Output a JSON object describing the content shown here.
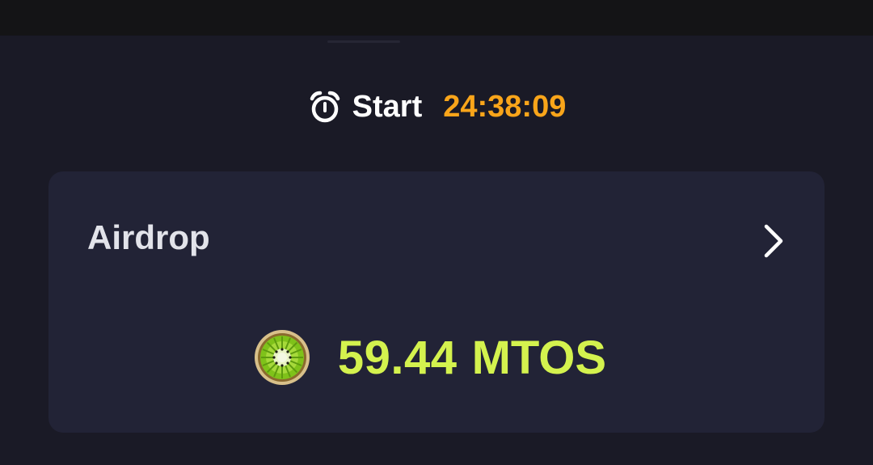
{
  "timer": {
    "icon": "alarm-clock-icon",
    "label": "Start",
    "countdown": "24:38:09",
    "countdown_color": "#f9a51a"
  },
  "airdrop_card": {
    "title": "Airdrop",
    "chevron_icon": "chevron-right-icon",
    "coin_icon": "kiwi-coin-icon",
    "balance_amount": "59.44",
    "balance_unit": "MTOS",
    "balance_color": "#d4f24e"
  },
  "colors": {
    "background": "#1a1a26",
    "card": "#222336",
    "top_bar": "#141416"
  }
}
